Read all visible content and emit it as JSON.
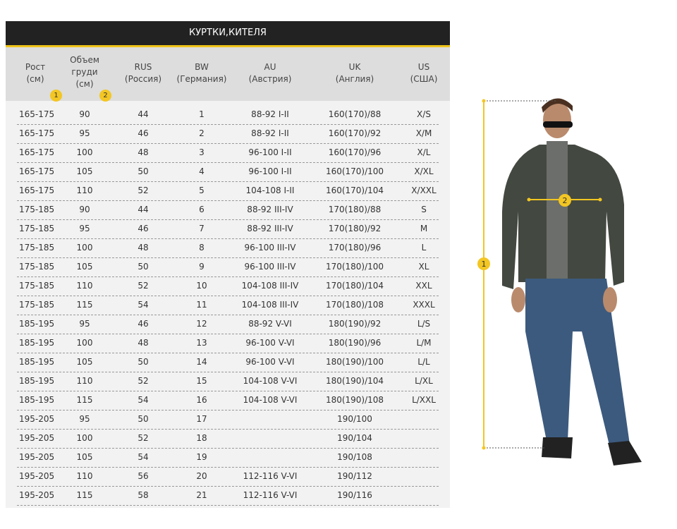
{
  "title": "КУРТКИ,КИТЕЛЯ",
  "headers": [
    [
      "Рост",
      "(см)"
    ],
    [
      "Объем",
      "груди",
      "(см)"
    ],
    [
      "RUS",
      "(Россия)"
    ],
    [
      "BW",
      "(Германия)"
    ],
    [
      "AU",
      "(Австрия)"
    ],
    [
      "UK",
      "(Англия)"
    ],
    [
      "US",
      "(США)"
    ]
  ],
  "badges": {
    "height": "1",
    "chest": "2"
  },
  "rows": [
    [
      "165-175",
      "90",
      "44",
      "1",
      "88-92  I-II",
      "160(170)/88",
      "X/S"
    ],
    [
      "165-175",
      "95",
      "46",
      "2",
      "88-92  I-II",
      "160(170)/92",
      "X/M"
    ],
    [
      "165-175",
      "100",
      "48",
      "3",
      "96-100  I-II",
      "160(170)/96",
      "X/L"
    ],
    [
      "165-175",
      "105",
      "50",
      "4",
      "96-100  I-II",
      "160(170)/100",
      "X/XL"
    ],
    [
      "165-175",
      "110",
      "52",
      "5",
      "104-108  I-II",
      "160(170)/104",
      "X/XXL"
    ],
    [
      "175-185",
      "90",
      "44",
      "6",
      "88-92  III-IV",
      "170(180)/88",
      "S"
    ],
    [
      "175-185",
      "95",
      "46",
      "7",
      "88-92  III-IV",
      "170(180)/92",
      "M"
    ],
    [
      "175-185",
      "100",
      "48",
      "8",
      "96-100  III-IV",
      "170(180)/96",
      "L"
    ],
    [
      "175-185",
      "105",
      "50",
      "9",
      "96-100  III-IV",
      "170(180)/100",
      "XL"
    ],
    [
      "175-185",
      "110",
      "52",
      "10",
      "104-108  III-IV",
      "170(180)/104",
      "XXL"
    ],
    [
      "175-185",
      "115",
      "54",
      "11",
      "104-108  III-IV",
      "170(180)/108",
      "XXXL"
    ],
    [
      "185-195",
      "95",
      "46",
      "12",
      "88-92  V-VI",
      "180(190)/92",
      "L/S"
    ],
    [
      "185-195",
      "100",
      "48",
      "13",
      "96-100  V-VI",
      "180(190)/96",
      "L/M"
    ],
    [
      "185-195",
      "105",
      "50",
      "14",
      "96-100  V-VI",
      "180(190)/100",
      "L/L"
    ],
    [
      "185-195",
      "110",
      "52",
      "15",
      "104-108  V-VI",
      "180(190)/104",
      "L/XL"
    ],
    [
      "185-195",
      "115",
      "54",
      "16",
      "104-108  V-VI",
      "180(190)/108",
      "L/XXL"
    ],
    [
      "195-205",
      "95",
      "50",
      "17",
      "",
      "190/100",
      ""
    ],
    [
      "195-205",
      "100",
      "52",
      "18",
      "",
      "190/104",
      ""
    ],
    [
      "195-205",
      "105",
      "54",
      "19",
      "",
      "190/108",
      ""
    ],
    [
      "195-205",
      "110",
      "56",
      "20",
      "112-116  V-VI",
      "190/112",
      ""
    ],
    [
      "195-205",
      "115",
      "58",
      "21",
      "112-116  V-VI",
      "190/116",
      ""
    ]
  ],
  "accent": "#f3c623"
}
